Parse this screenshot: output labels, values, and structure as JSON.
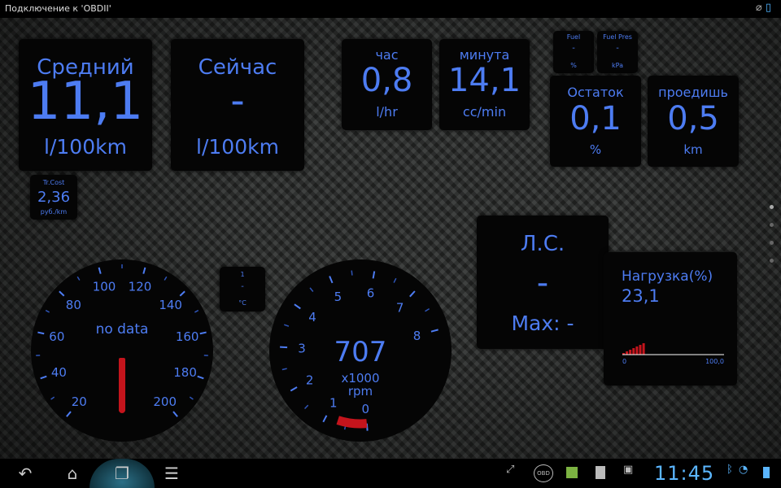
{
  "status_bar": {
    "title": "Подключение к 'OBDII'"
  },
  "avg": {
    "label": "Средний",
    "value": "11,1",
    "unit": "l/100km"
  },
  "now": {
    "label": "Сейчас",
    "value": "-",
    "unit": "l/100km"
  },
  "hour": {
    "label": "час",
    "value": "0,8",
    "unit": "l/hr"
  },
  "minute": {
    "label": "минута",
    "value": "14,1",
    "unit": "cc/min"
  },
  "fuel": {
    "label": "Fuel",
    "value": "-",
    "unit": "%"
  },
  "fuel_pres": {
    "label": "Fuel Pres",
    "value": "-",
    "unit": "kPa"
  },
  "remaining": {
    "label": "Остаток",
    "value": "0,1",
    "unit": "%"
  },
  "range": {
    "label": "проедишь",
    "value": "0,5",
    "unit": "km"
  },
  "trip_cost": {
    "label": "Tr.Cost",
    "value": "2,36",
    "unit": "руб./km"
  },
  "temp": {
    "label": "1",
    "value": "-",
    "unit": "°C"
  },
  "speed_gauge": {
    "ticks": [
      "20",
      "40",
      "60",
      "80",
      "100",
      "120",
      "140",
      "160",
      "180",
      "200"
    ],
    "readout": "no data"
  },
  "rpm_gauge": {
    "ticks": [
      "0",
      "1",
      "2",
      "3",
      "4",
      "5",
      "6",
      "7",
      "8"
    ],
    "value": "707",
    "multiplier": "x1000",
    "unit": "rpm"
  },
  "hp": {
    "label": "Л.С.",
    "value": "-",
    "max": "Max: -"
  },
  "load": {
    "label": "Нагрузка(%)",
    "value": "23,1",
    "axis_min": "0",
    "axis_max": "100,0"
  },
  "clock": "11:45",
  "colors": {
    "accent": "#4d7cf2",
    "needle": "#c4141c",
    "clock": "#5bb6ff"
  }
}
